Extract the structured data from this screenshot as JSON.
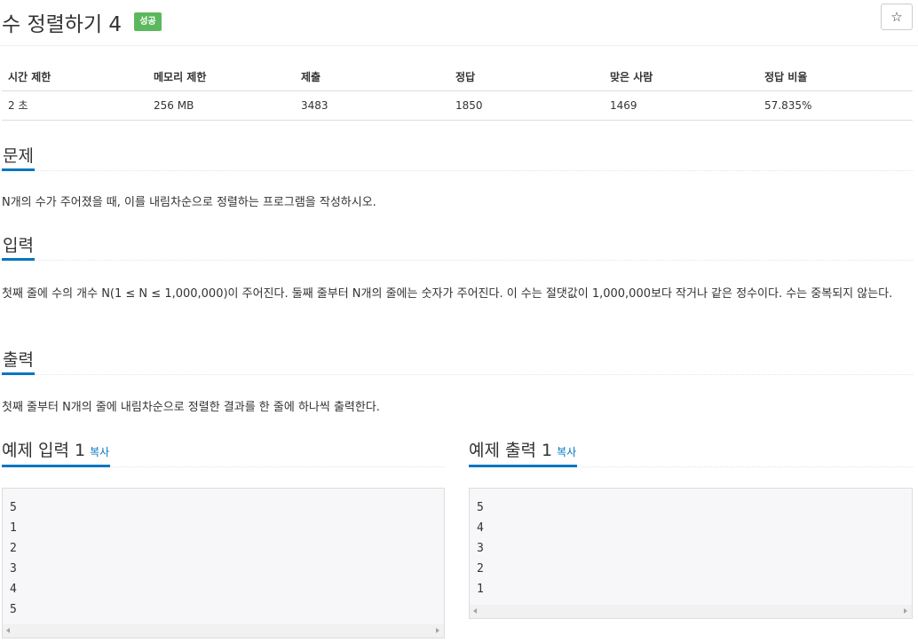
{
  "problem": {
    "title": "수 정렬하기 4",
    "badge": "성공",
    "star_icon": "☆"
  },
  "info_table": {
    "headers": [
      "시간 제한",
      "메모리 제한",
      "제출",
      "정답",
      "맞은 사람",
      "정답 비율"
    ],
    "values": [
      "2 초",
      "256 MB",
      "3483",
      "1850",
      "1469",
      "57.835%"
    ]
  },
  "sections": {
    "description": {
      "heading": "문제",
      "text": "N개의 수가 주어졌을 때, 이를 내림차순으로 정렬하는 프로그램을 작성하시오."
    },
    "input": {
      "heading": "입력",
      "text": "첫째 줄에 수의 개수 N(1 ≤ N ≤ 1,000,000)이 주어진다. 둘째 줄부터 N개의 줄에는 숫자가 주어진다. 이 수는 절댓값이 1,000,000보다 작거나 같은 정수이다. 수는 중복되지 않는다."
    },
    "output": {
      "heading": "출력",
      "text": "첫째 줄부터 N개의 줄에 내림차순으로 정렬한 결과를 한 줄에 하나씩 출력한다."
    }
  },
  "samples": {
    "input": {
      "heading": "예제 입력 1",
      "copy_label": "복사",
      "lines": [
        "5",
        "1",
        "2",
        "3",
        "4",
        "5"
      ]
    },
    "output": {
      "heading": "예제 출력 1",
      "copy_label": "복사",
      "lines": [
        "5",
        "4",
        "3",
        "2",
        "1"
      ]
    }
  }
}
